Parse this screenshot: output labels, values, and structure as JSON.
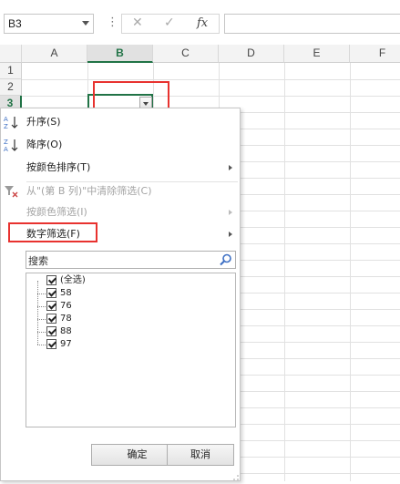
{
  "formula_bar": {
    "name_box": "B3",
    "separator": "⋮",
    "cancel_glyph": "✕",
    "enter_glyph": "✓",
    "function_glyph": "fx",
    "formula": ""
  },
  "grid": {
    "columns": [
      "A",
      "B",
      "C",
      "D",
      "E",
      "F"
    ],
    "rows": [
      "1",
      "2",
      "3"
    ],
    "active_cell": "B3",
    "accent_color": "#217346"
  },
  "menu": {
    "sort_asc": "升序(S)",
    "sort_desc": "降序(O)",
    "sort_by_color": "按颜色排序(T)",
    "clear_filter": "从\"(第 B 列)\"中清除筛选(C)",
    "filter_by_color": "按颜色筛选(I)",
    "number_filter": "数字筛选(F)",
    "search_placeholder": "搜索",
    "items": [
      {
        "label": "(全选)",
        "checked": true
      },
      {
        "label": "58",
        "checked": true
      },
      {
        "label": "76",
        "checked": true
      },
      {
        "label": "78",
        "checked": true
      },
      {
        "label": "88",
        "checked": true
      },
      {
        "label": "97",
        "checked": true
      }
    ],
    "ok": "确定",
    "cancel": "取消"
  },
  "highlight_color": "#e8322f"
}
